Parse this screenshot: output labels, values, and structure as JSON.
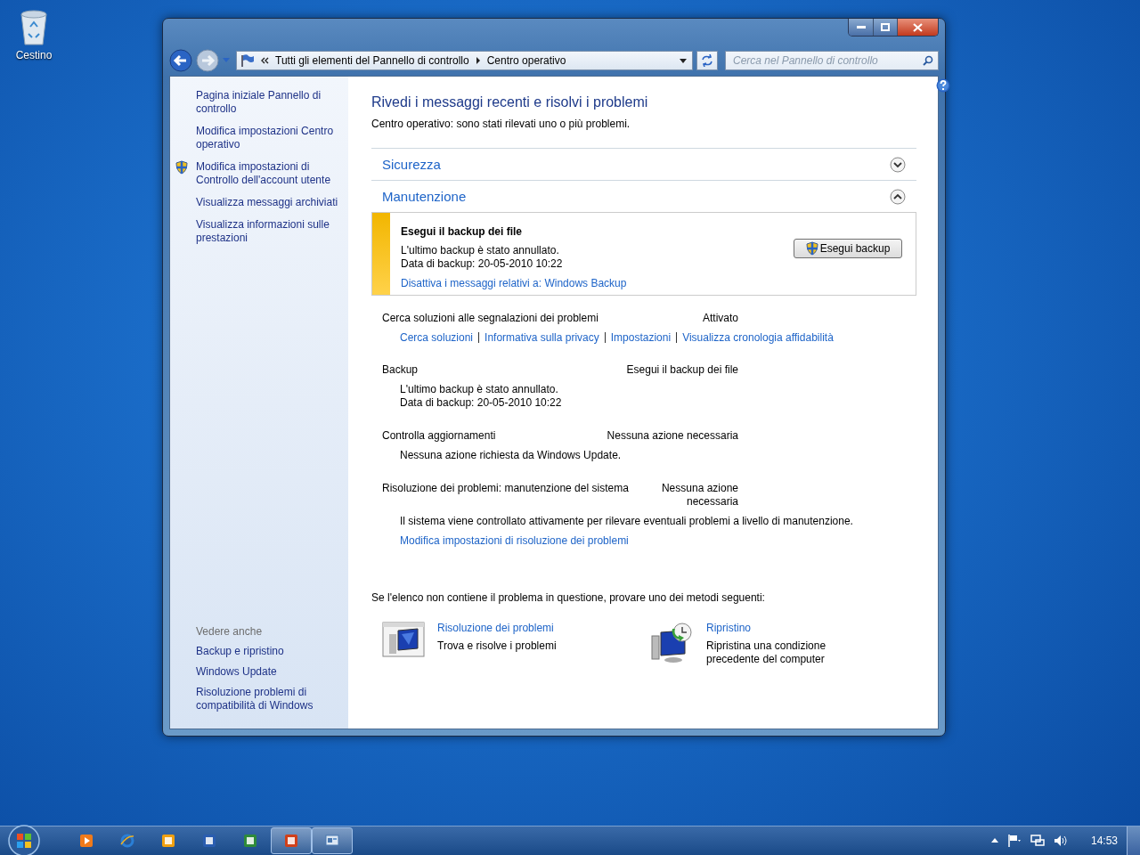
{
  "desktop_icons": [
    {
      "label": "Cestino"
    }
  ],
  "window": {
    "breadcrumb": [
      "Tutti gli elementi del Pannello di controllo",
      "Centro operativo"
    ],
    "search": {
      "placeholder": "Cerca nel Pannello di controllo"
    },
    "sidebar": {
      "links": [
        {
          "label": "Pagina iniziale Pannello di controllo",
          "shield": false
        },
        {
          "label": "Modifica impostazioni Centro operativo",
          "shield": false
        },
        {
          "label": "Modifica impostazioni di Controllo dell'account utente",
          "shield": true
        },
        {
          "label": "Visualizza messaggi archiviati",
          "shield": false
        },
        {
          "label": "Visualizza informazioni sulle prestazioni",
          "shield": false
        }
      ],
      "see_also_title": "Vedere anche",
      "see_also": [
        "Backup e ripristino",
        "Windows Update",
        "Risoluzione problemi di compatibilità di Windows"
      ]
    },
    "title": "Rivedi i messaggi recenti e risolvi i problemi",
    "subtitle": "Centro operativo: sono stati rilevati uno o più problemi.",
    "sections": [
      {
        "label": "Sicurezza",
        "expanded": false
      },
      {
        "label": "Manutenzione",
        "expanded": true
      }
    ],
    "alert": {
      "title": "Esegui il backup dei file",
      "lines": [
        "L'ultimo backup è stato annullato.",
        "Data di backup: 20-05-2010 10:22"
      ],
      "link": "Disattiva i messaggi relativi a: Windows Backup",
      "button": "Esegui backup"
    },
    "items": [
      {
        "name": "Cerca soluzioni alle segnalazioni dei problemi",
        "status": "Attivato",
        "links": [
          "Cerca soluzioni",
          "Informativa sulla privacy",
          "Impostazioni",
          "Visualizza cronologia affidabilità"
        ]
      },
      {
        "name": "Backup",
        "status": "Esegui il backup dei file",
        "lines": [
          "L'ultimo backup è stato annullato.",
          "Data di backup: 20-05-2010 10:22"
        ]
      },
      {
        "name": "Controlla aggiornamenti",
        "status": "Nessuna azione necessaria",
        "lines": [
          "Nessuna azione richiesta da Windows Update."
        ]
      },
      {
        "name": "Risoluzione dei problemi: manutenzione del sistema",
        "status": "Nessuna azione necessaria",
        "lines": [
          "Il sistema viene controllato attivamente per rilevare eventuali problemi a livello di manutenzione."
        ],
        "links": [
          "Modifica impostazioni di risoluzione dei problemi"
        ]
      }
    ],
    "footer_prompt": "Se l'elenco non contiene il problema in questione, provare uno dei metodi seguenti:",
    "tools": [
      {
        "kind": "troubleshoot",
        "title": "Risoluzione dei problemi",
        "description": "Trova e risolve i problemi"
      },
      {
        "kind": "restore",
        "title": "Ripristino",
        "description": "Ripristina una condizione precedente del computer"
      }
    ]
  },
  "taskbar": {
    "apps": [
      {
        "kind": "media",
        "open": false
      },
      {
        "kind": "browser",
        "open": false
      },
      {
        "kind": "mail",
        "open": false
      },
      {
        "kind": "document",
        "open": false
      },
      {
        "kind": "spreadsheet",
        "open": false
      },
      {
        "kind": "slides",
        "open": true
      },
      {
        "kind": "panel",
        "open": true
      }
    ],
    "clock": "14:53"
  }
}
